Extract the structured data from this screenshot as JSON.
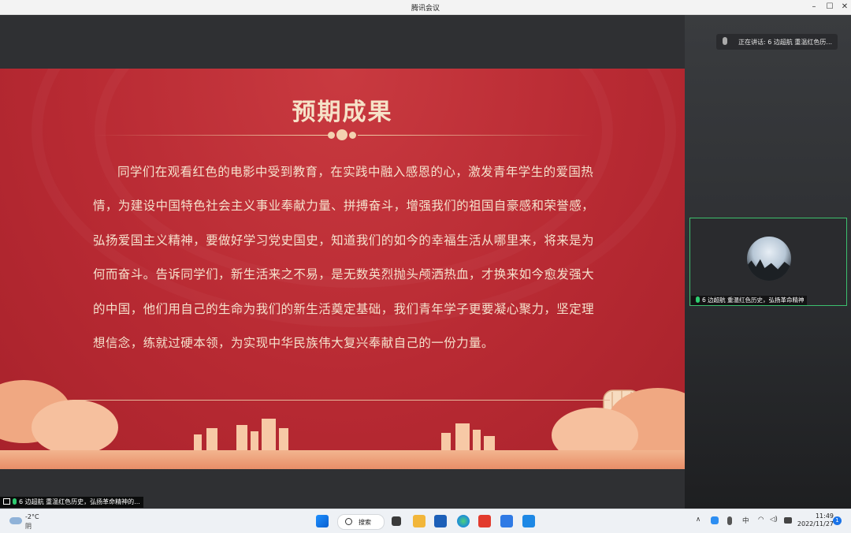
{
  "window": {
    "title": "腾讯会议"
  },
  "slide": {
    "title": "预期成果",
    "body": "同学们在观看红色的电影中受到教育，在实践中融入感恩的心，激发青年学生的爱国热情，为建设中国特色社会主义事业奉献力量、拼搏奋斗，增强我们的祖国自豪感和荣誉感，弘扬爱国主义精神，要做好学习党史国史，知道我们的如今的幸福生活从哪里来，将来是为何而奋斗。告诉同学们，新生活来之不易，是无数英烈抛头颅洒热血，才换来如今愈发强大的中国，他们用自己的生命为我们的新生活奠定基础，我们青年学子更要凝心聚力，坚定理想信念，练就过硬本领，为实现中华民族伟大复兴奉献自己的一份力量。"
  },
  "meeting": {
    "speaking_label": "正在讲话: 6 边超航  重温红色历...",
    "participant_label": "6 边超航  重温红色历史，弘扬革命精神",
    "bottom_status": "6 边超航  重温红色历史，弘扬革命精神的..."
  },
  "taskbar": {
    "weather_temp": "-2°C",
    "weather_desc": "阴",
    "search_label": "搜索",
    "ime_label": "中",
    "time": "11:49",
    "date": "2022/11/27",
    "notification_count": "1"
  },
  "colors": {
    "slide_red": "#b82a33",
    "accent_text": "#f6e2c8",
    "active_green": "#3cc06e"
  }
}
